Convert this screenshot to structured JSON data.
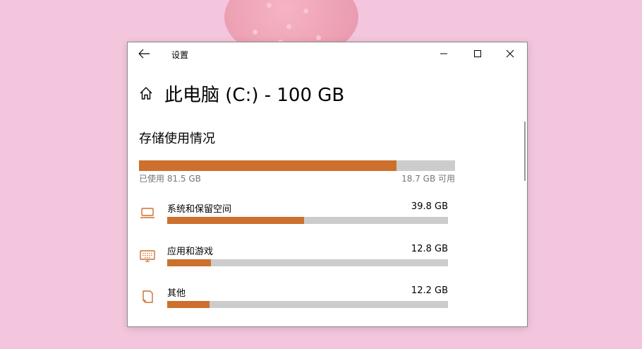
{
  "window": {
    "title": "设置",
    "page_title": "此电脑 (C:) - 100 GB"
  },
  "storage": {
    "section_title": "存储使用情况",
    "used_label": "已使用 81.5 GB",
    "free_label": "18.7 GB 可用",
    "used_fraction": 0.815
  },
  "categories": [
    {
      "name": "系统和保留空间",
      "size": "39.8 GB",
      "fraction": 0.488,
      "icon": "laptop-icon"
    },
    {
      "name": "应用和游戏",
      "size": "12.8 GB",
      "fraction": 0.157,
      "icon": "keyboard-icon"
    },
    {
      "name": "其他",
      "size": "12.2 GB",
      "fraction": 0.15,
      "icon": "document-icon"
    }
  ],
  "colors": {
    "accent": "#cd6f2d",
    "bar_track": "#cccccc",
    "background": "#f4c6dd"
  }
}
